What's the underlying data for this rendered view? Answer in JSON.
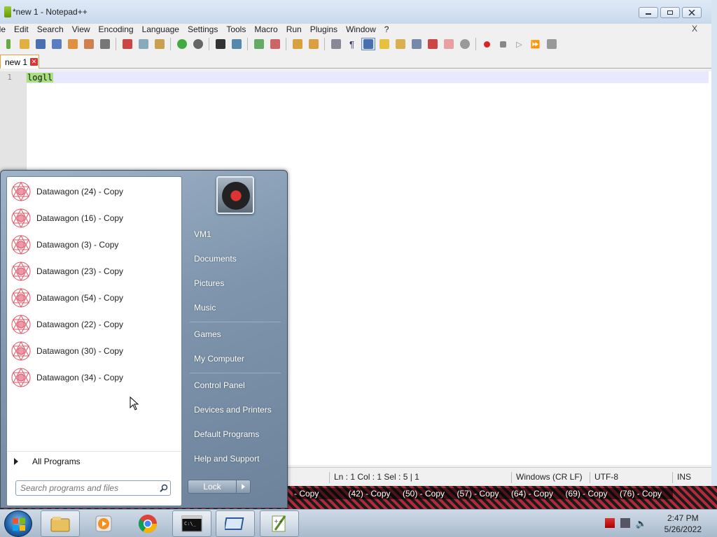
{
  "window": {
    "title": "*new 1 - Notepad++",
    "menu": [
      "ile",
      "Edit",
      "Search",
      "View",
      "Encoding",
      "Language",
      "Settings",
      "Tools",
      "Macro",
      "Run",
      "Plugins",
      "Window",
      "?"
    ],
    "menu_close": "X",
    "tab_label": "new 1",
    "line_number": "1",
    "editor_text": "logll"
  },
  "status": {
    "position": "Ln : 1    Col : 1    Sel : 5 | 1",
    "eol": "Windows (CR LF)",
    "encoding": "UTF-8",
    "mode": "INS"
  },
  "desktop_labels": [
    "- Copy",
    "(42) - Copy",
    "(50) - Copy",
    "(57) - Copy",
    "(64) - Copy",
    "(69) - Copy",
    "(76) - Copy"
  ],
  "startmenu": {
    "programs": [
      "Datawagon (24) - Copy",
      "Datawagon (16) - Copy",
      "Datawagon (3) - Copy",
      "Datawagon (23) - Copy",
      "Datawagon (54) - Copy",
      "Datawagon (22) - Copy",
      "Datawagon (30) - Copy",
      "Datawagon (34) - Copy"
    ],
    "all_programs": "All Programs",
    "search_placeholder": "Search programs and files",
    "right_links": [
      "VM1",
      "Documents",
      "Pictures",
      "Music",
      "Games",
      "My Computer",
      "Control Panel",
      "Devices and Printers",
      "Default Programs",
      "Help and Support"
    ],
    "lock_label": "Lock"
  },
  "taskbar": {
    "time": "2:47 PM",
    "date": "5/26/2022",
    "apps": [
      "windows-explorer-icon",
      "media-player-icon",
      "chrome-icon",
      "cmd-icon",
      "virtual-window-icon",
      "notepad-plus-plus-icon"
    ]
  }
}
